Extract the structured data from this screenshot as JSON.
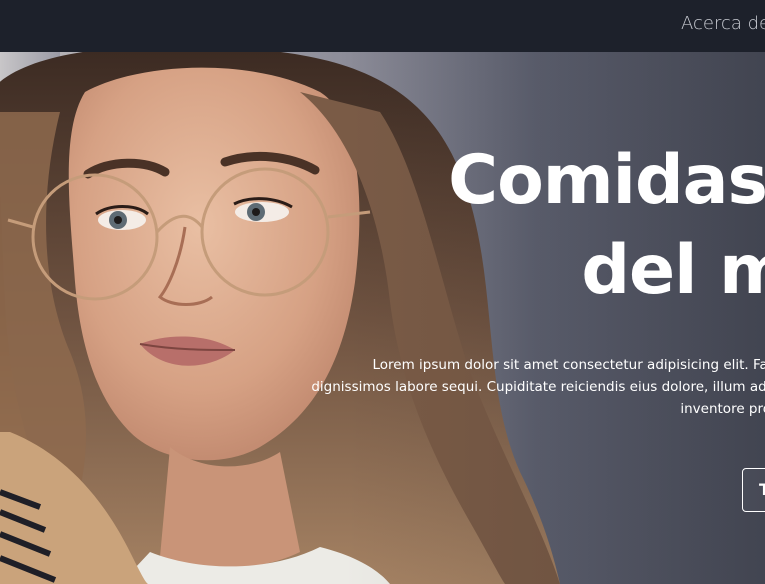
{
  "nav": {
    "about_label": "Acerca de"
  },
  "hero": {
    "title_line1": "Comidas",
    "title_line2": "del m",
    "desc_line1": "Lorem ipsum dolor sit amet consectetur adipisicing elit. Faci",
    "desc_line2": "dignissimos labore sequi. Cupiditate reiciendis eius dolore, illum adip",
    "desc_line3": "inventore prov",
    "cta_label": "T"
  },
  "colors": {
    "navbar": "#1d212b",
    "title_text": "#ffffff",
    "nav_text": "#c9ccd3"
  }
}
